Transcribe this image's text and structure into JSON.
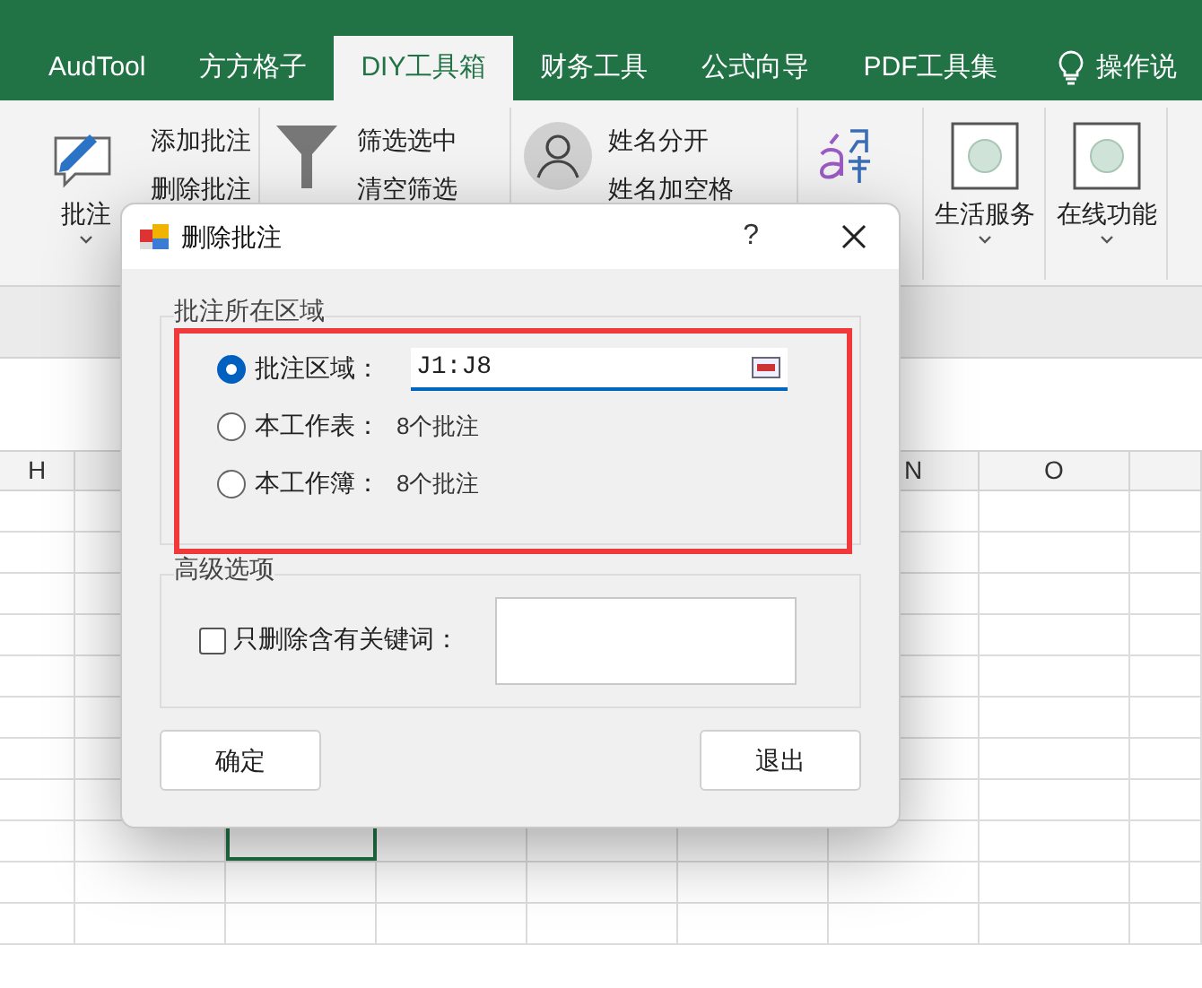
{
  "ribbon_tabs": [
    {
      "label": "AudTool",
      "selected": false
    },
    {
      "label": "方方格子",
      "selected": false
    },
    {
      "label": "DIY工具箱",
      "selected": true
    },
    {
      "label": "财务工具",
      "selected": false
    },
    {
      "label": "公式向导",
      "selected": false
    },
    {
      "label": "PDF工具集",
      "selected": false
    }
  ],
  "tell_me": "操作说",
  "ribbon_groups": [
    {
      "kind": "comment",
      "label": "批注",
      "items": [
        "添加批注",
        "删除批注"
      ]
    },
    {
      "kind": "filter",
      "items": [
        "筛选选中",
        "清空筛选"
      ]
    },
    {
      "kind": "person",
      "items": [
        "姓名分开",
        "姓名加空格"
      ]
    },
    {
      "kind": "pinyin"
    },
    {
      "kind": "tile",
      "label": "生活服务"
    },
    {
      "kind": "tile",
      "label": "在线功能"
    }
  ],
  "column_headers": [
    "H",
    "N",
    "O"
  ],
  "dialog": {
    "title": "删除批注",
    "help": "?",
    "scope_group": {
      "label": "批注所在区域",
      "options": [
        {
          "label": "批注区域：",
          "selected": true,
          "value": "J1:J8"
        },
        {
          "label": "本工作表：",
          "selected": false,
          "count": "8个批注"
        },
        {
          "label": "本工作簿：",
          "selected": false,
          "count": "8个批注"
        }
      ]
    },
    "advanced_group": {
      "label": "高级选项",
      "keyword_filter": {
        "label": "只删除含有关键词：",
        "checked": false
      }
    },
    "buttons": [
      "确定",
      "退出"
    ]
  }
}
